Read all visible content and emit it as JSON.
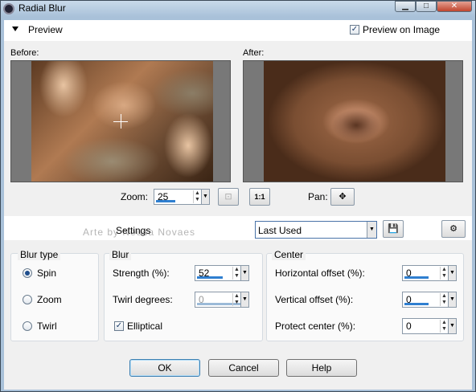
{
  "window": {
    "title": "Radial Blur"
  },
  "preview": {
    "label": "Preview",
    "preview_on_image_label": "Preview on Image",
    "preview_on_image_checked": true,
    "before_label": "Before:",
    "after_label": "After:"
  },
  "zoom": {
    "label": "Zoom:",
    "value": "25",
    "fit_icon": "fit-icon",
    "actual_size_label": "1:1"
  },
  "pan": {
    "label": "Pan:",
    "icon": "move-icon"
  },
  "settings": {
    "label": "Settings",
    "selected": "Last Used",
    "watermark": "Arte by Neusa Novaes"
  },
  "blur_type": {
    "title": "Blur type",
    "options": [
      "Spin",
      "Zoom",
      "Twirl"
    ],
    "selected": "Spin"
  },
  "blur": {
    "title": "Blur",
    "strength_label": "Strength (%):",
    "strength_value": "52",
    "twirl_label": "Twirl degrees:",
    "twirl_value": "0",
    "elliptical_label": "Elliptical",
    "elliptical_checked": true
  },
  "center": {
    "title": "Center",
    "h_offset_label": "Horizontal offset (%):",
    "h_offset_value": "0",
    "v_offset_label": "Vertical offset (%):",
    "v_offset_value": "0",
    "protect_label": "Protect center (%):",
    "protect_value": "0"
  },
  "buttons": {
    "ok": "OK",
    "cancel": "Cancel",
    "help": "Help"
  },
  "colors": {
    "accent": "#2f7fd0",
    "title_bar": "#a9c1d9",
    "close": "#c0452e"
  }
}
